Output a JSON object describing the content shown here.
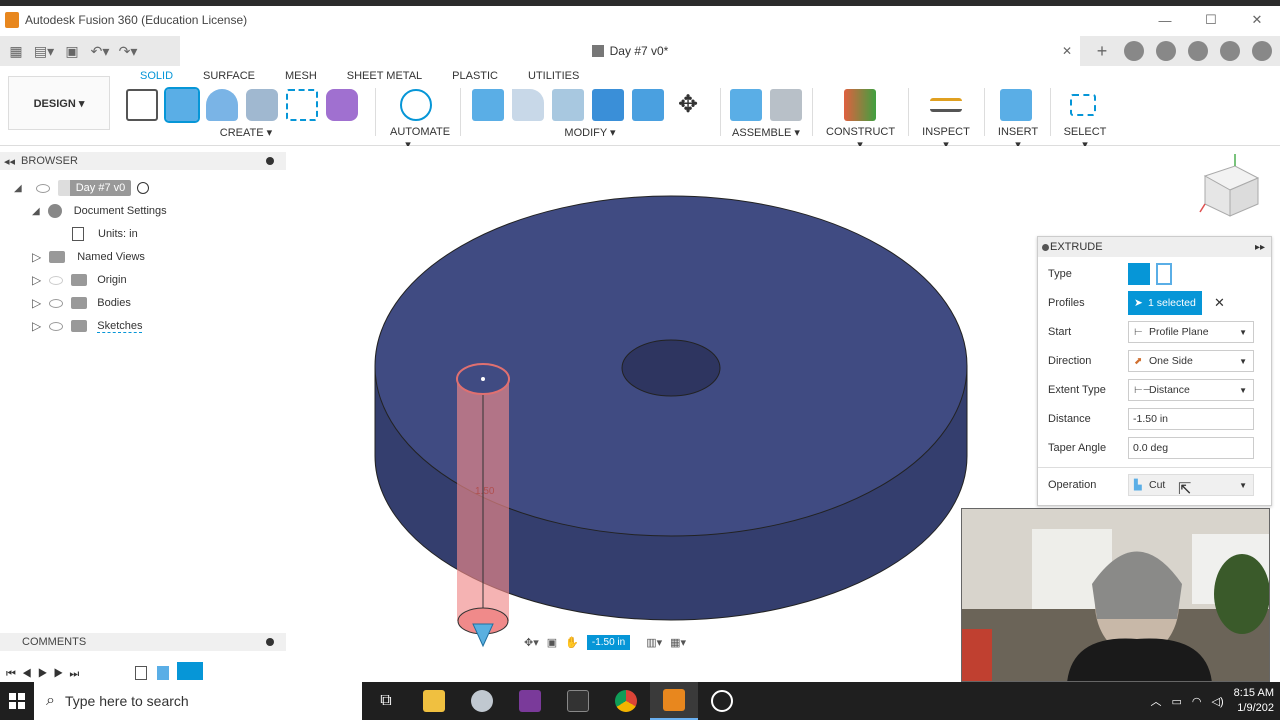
{
  "window": {
    "title": "Autodesk Fusion 360 (Education License)",
    "min": "—",
    "max": "☐",
    "close": "✕"
  },
  "tabbar": {
    "doc_title": "Day #7 v0*",
    "close": "✕",
    "plus": "+"
  },
  "ribbon": {
    "workspace": "DESIGN ▾",
    "tabs": [
      "SOLID",
      "SURFACE",
      "MESH",
      "SHEET METAL",
      "PLASTIC",
      "UTILITIES"
    ],
    "groups": {
      "create": "CREATE ▾",
      "automate": "AUTOMATE ▾",
      "modify": "MODIFY ▾",
      "assemble": "ASSEMBLE ▾",
      "construct": "CONSTRUCT ▾",
      "inspect": "INSPECT ▾",
      "insert": "INSERT ▾",
      "select": "SELECT ▾"
    }
  },
  "browser": {
    "title": "BROWSER",
    "root": "Day #7 v0",
    "items": [
      {
        "label": "Document Settings"
      },
      {
        "label": "Units: in"
      },
      {
        "label": "Named Views"
      },
      {
        "label": "Origin"
      },
      {
        "label": "Bodies"
      },
      {
        "label": "Sketches"
      }
    ]
  },
  "comments": {
    "title": "COMMENTS"
  },
  "extrude": {
    "title": "EXTRUDE",
    "type_label": "Type",
    "profiles_label": "Profiles",
    "profiles_value": "1 selected",
    "start_label": "Start",
    "start_value": "Profile Plane",
    "direction_label": "Direction",
    "direction_value": "One Side",
    "extent_label": "Extent Type",
    "extent_value": "Distance",
    "distance_label": "Distance",
    "distance_value": "-1.50 in",
    "taper_label": "Taper Angle",
    "taper_value": "0.0 deg",
    "operation_label": "Operation",
    "operation_value": "Cut"
  },
  "viewport": {
    "dimension_input": "-1.50 in",
    "faint_label": "1.50"
  },
  "taskbar": {
    "search_placeholder": "Type here to search",
    "time": "8:15 AM",
    "date": "1/9/202"
  },
  "colors": {
    "accent": "#0696d7",
    "body": "#3f4a7e",
    "cut": "#f0a0a0"
  }
}
